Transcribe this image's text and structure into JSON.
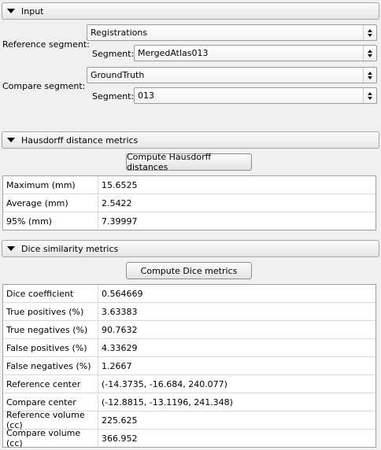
{
  "input_section": {
    "title": "Input",
    "reference_label": "Reference segment:",
    "reference_node": "Registrations",
    "reference_segment_label": "Segment:",
    "reference_segment": "MergedAtlas013",
    "compare_label": "Compare segment:",
    "compare_node": "GroundTruth",
    "compare_segment_label": "Segment:",
    "compare_segment": "013"
  },
  "hausdorff_section": {
    "title": "Hausdorff distance metrics",
    "button_label": "Compute Hausdorff distances",
    "rows": [
      {
        "label": "Maximum (mm)",
        "value": "15.6525"
      },
      {
        "label": "Average (mm)",
        "value": "2.5422"
      },
      {
        "label": "95% (mm)",
        "value": "7.39997"
      }
    ]
  },
  "dice_section": {
    "title": "Dice similarity metrics",
    "button_label": "Compute Dice metrics",
    "rows": [
      {
        "label": "Dice coefficient",
        "value": "0.564669"
      },
      {
        "label": "True positives (%)",
        "value": "3.63383"
      },
      {
        "label": "True negatives (%)",
        "value": "90.7632"
      },
      {
        "label": "False positives (%)",
        "value": "4.33629"
      },
      {
        "label": "False negatives (%)",
        "value": "1.2667"
      },
      {
        "label": "Reference center",
        "value": "(-14.3735, -16.684, 240.077)"
      },
      {
        "label": "Compare center",
        "value": "(-12.8815, -13.1196, 241.348)"
      },
      {
        "label": "Reference volume (cc)",
        "value": "225.625"
      },
      {
        "label": "Compare volume (cc)",
        "value": "366.952"
      }
    ]
  },
  "icons": {
    "collapse": "chevron-down-icon",
    "combo_arrows": "spin-arrows-icon"
  }
}
